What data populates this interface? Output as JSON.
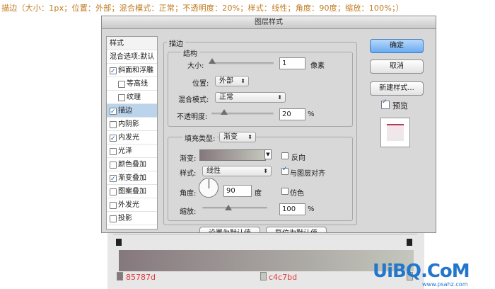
{
  "caption": "描边（大小：1px；位置：外部；混合模式：正常；不透明度：20%；样式：线性；角度：90度；缩放：100%；）",
  "dialog": {
    "title": "图层样式",
    "styles_list": {
      "header": "样式",
      "items": [
        {
          "label": "混合选项:默认",
          "checkbox": false,
          "checked": false,
          "selected": false,
          "indent": 0
        },
        {
          "label": "斜面和浮雕",
          "checkbox": true,
          "checked": true,
          "selected": false,
          "indent": 0
        },
        {
          "label": "等高线",
          "checkbox": true,
          "checked": false,
          "selected": false,
          "indent": 1
        },
        {
          "label": "纹理",
          "checkbox": true,
          "checked": false,
          "selected": false,
          "indent": 1
        },
        {
          "label": "描边",
          "checkbox": true,
          "checked": true,
          "selected": true,
          "indent": 0
        },
        {
          "label": "内阴影",
          "checkbox": true,
          "checked": false,
          "selected": false,
          "indent": 0
        },
        {
          "label": "内发光",
          "checkbox": true,
          "checked": true,
          "selected": false,
          "indent": 0
        },
        {
          "label": "光泽",
          "checkbox": true,
          "checked": false,
          "selected": false,
          "indent": 0
        },
        {
          "label": "颜色叠加",
          "checkbox": true,
          "checked": false,
          "selected": false,
          "indent": 0
        },
        {
          "label": "渐变叠加",
          "checkbox": true,
          "checked": true,
          "selected": false,
          "indent": 0
        },
        {
          "label": "图案叠加",
          "checkbox": true,
          "checked": false,
          "selected": false,
          "indent": 0
        },
        {
          "label": "外发光",
          "checkbox": true,
          "checked": false,
          "selected": false,
          "indent": 0
        },
        {
          "label": "投影",
          "checkbox": true,
          "checked": false,
          "selected": false,
          "indent": 0
        }
      ]
    },
    "stroke": {
      "group_title": "描边",
      "structure_title": "结构",
      "size_label": "大小:",
      "size_value": "1",
      "size_unit": "像素",
      "size_level": 0.01,
      "position_label": "位置:",
      "position_value": "外部",
      "blend_label": "混合模式:",
      "blend_value": "正常",
      "opacity_label": "不透明度:",
      "opacity_value": "20",
      "opacity_unit": "%",
      "opacity_level": 0.2
    },
    "fill": {
      "type_label": "填充类型:",
      "type_value": "渐变",
      "gradient_label": "渐变:",
      "reverse_label": "反向",
      "reverse_checked": false,
      "style_label": "样式:",
      "style_value": "线性",
      "align_label": "与图层对齐",
      "align_checked": true,
      "angle_label": "角度:",
      "angle_value": "90",
      "angle_unit": "度",
      "dither_label": "仿色",
      "dither_checked": false,
      "scale_label": "缩放:",
      "scale_value": "100",
      "scale_unit": "%",
      "scale_level": 0.4
    },
    "bottom_buttons": {
      "set_default": "设置为默认值",
      "reset_default": "复位为默认值"
    },
    "right_panel": {
      "ok": "确定",
      "cancel": "取消",
      "new_style": "新建样式...",
      "preview_label": "预览",
      "preview_checked": true
    }
  },
  "gradient_editor": {
    "stop_left_hex": "85787d",
    "stop_mid_hex": "c4c7bd",
    "color_start": "#85787d",
    "color_end": "#c4c7bd"
  },
  "watermark": {
    "logo": "UiBQ.CoM",
    "url": "www.psahz.com"
  }
}
